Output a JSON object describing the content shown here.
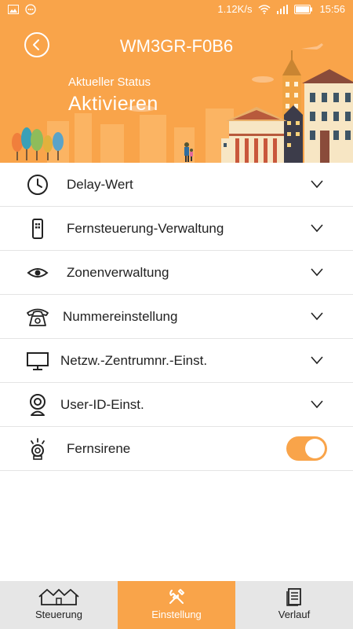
{
  "status_bar": {
    "network_speed": "1.12K/s",
    "time": "15:56"
  },
  "header": {
    "title": "WM3GR-F0B6",
    "status_label": "Aktueller Status",
    "status_value": "Aktivieren"
  },
  "settings": [
    {
      "label": "Delay-Wert",
      "icon": "clock-icon"
    },
    {
      "label": "Fernsteuerung-Verwaltung",
      "icon": "remote-icon"
    },
    {
      "label": "Zonenverwaltung",
      "icon": "eye-icon"
    },
    {
      "label": "Nummereinstellung",
      "icon": "telephone-icon"
    },
    {
      "label": "Netzw.-Zentrumnr.-Einst.",
      "icon": "monitor-icon"
    },
    {
      "label": "User-ID-Einst.",
      "icon": "user-camera-icon"
    },
    {
      "label": "Fernsirene",
      "icon": "siren-icon",
      "toggle_on": true
    }
  ],
  "bottom_nav": [
    {
      "label": "Steuerung",
      "icon": "houses-icon",
      "active": false
    },
    {
      "label": "Einstellung",
      "icon": "tools-icon",
      "active": true
    },
    {
      "label": "Verlauf",
      "icon": "document-icon",
      "active": false
    }
  ],
  "colors": {
    "accent": "#f9a44a",
    "nav_bg": "#e6e6e6"
  }
}
